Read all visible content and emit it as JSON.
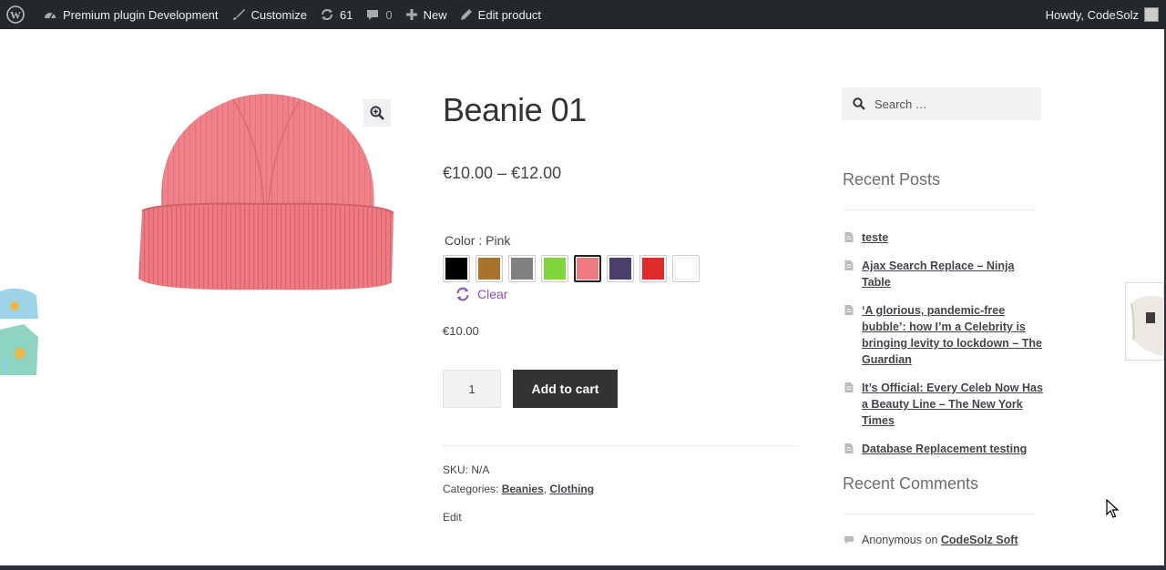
{
  "adminbar": {
    "site_name": "Premium plugin Development",
    "customize": "Customize",
    "updates_count": "61",
    "comments_count": "0",
    "new": "New",
    "edit_product": "Edit product",
    "howdy": "Howdy, CodeSolz"
  },
  "product": {
    "title": "Beanie 01",
    "price_range": "€10.00 – €12.00",
    "color_label": "Color : Pink",
    "swatches": [
      {
        "name": "black",
        "color": "#000000"
      },
      {
        "name": "brown",
        "color": "#a8742d"
      },
      {
        "name": "gray",
        "color": "#808080"
      },
      {
        "name": "green",
        "color": "#7ed63a"
      },
      {
        "name": "pink",
        "color": "#ef7a82",
        "selected": true
      },
      {
        "name": "purple",
        "color": "#4b3f6e"
      },
      {
        "name": "red",
        "color": "#e02b2b"
      },
      {
        "name": "white",
        "color": "#ffffff"
      }
    ],
    "clear_label": "Clear",
    "variation_price": "€10.00",
    "quantity": "1",
    "add_to_cart": "Add to cart",
    "sku_label": "SKU: N/A",
    "categories_label": "Categories:",
    "categories": [
      "Beanies",
      "Clothing"
    ],
    "edit_label": "Edit"
  },
  "sidebar": {
    "search_placeholder": "Search …",
    "recent_posts_title": "Recent Posts",
    "recent_posts": [
      "teste",
      "Ajax Search Replace – Ninja Table",
      "‘A glorious, pandemic-free bubble’: how I’m a Celebrity is bringing levity to lockdown – The Guardian",
      "It’s Official: Every Celeb Now Has a Beauty Line – The New York Times",
      "Database Replacement testing"
    ],
    "recent_comments_title": "Recent Comments",
    "recent_comments": [
      {
        "author": "Anonymous",
        "on": "on",
        "post": "CodeSolz Soft"
      }
    ]
  },
  "colors": {
    "adminbar_bg": "#23282d",
    "accent_purple": "#8e4fb6",
    "button_dark": "#333333",
    "beanie_pink": "#ef7a82"
  }
}
